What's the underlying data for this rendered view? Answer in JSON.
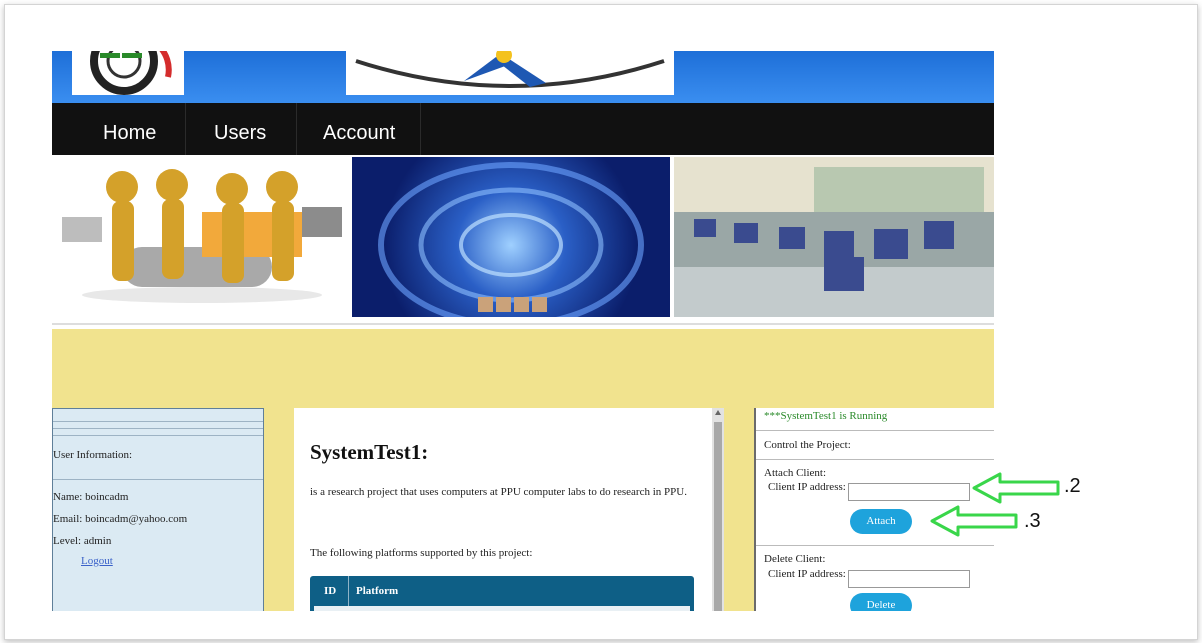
{
  "nav": {
    "items": [
      "Home",
      "Users",
      "Account"
    ]
  },
  "user_info": {
    "heading": "User Information:",
    "name": "Name: boincadm",
    "email": "Email: boincadm@yahoo.com",
    "level": "Level: admin",
    "logout": "Logout"
  },
  "project": {
    "title": "SystemTest1:",
    "description": "is a research project that uses computers at PPU computer labs to do research in PPU.",
    "platforms_intro": "The following platforms supported by this project:",
    "table_headers": [
      "ID",
      "Platform"
    ]
  },
  "control": {
    "status": "***SystemTest1 is Running",
    "heading": "Control the Project:",
    "attach_title": "Attach Client:",
    "attach_label": "Client IP address:",
    "attach_button": "Attach",
    "delete_title": "Delete Client:",
    "delete_label": "Client IP address:",
    "delete_button": "Delete"
  },
  "annotations": {
    "step2": ".2",
    "step3": ".3"
  },
  "colors": {
    "nav_bg": "#111111",
    "banner": "#2a80e6",
    "content_bg": "#f1e38e",
    "button": "#1ea3dc",
    "status_green": "#2a8a2a",
    "arrow": "#39d64a"
  }
}
